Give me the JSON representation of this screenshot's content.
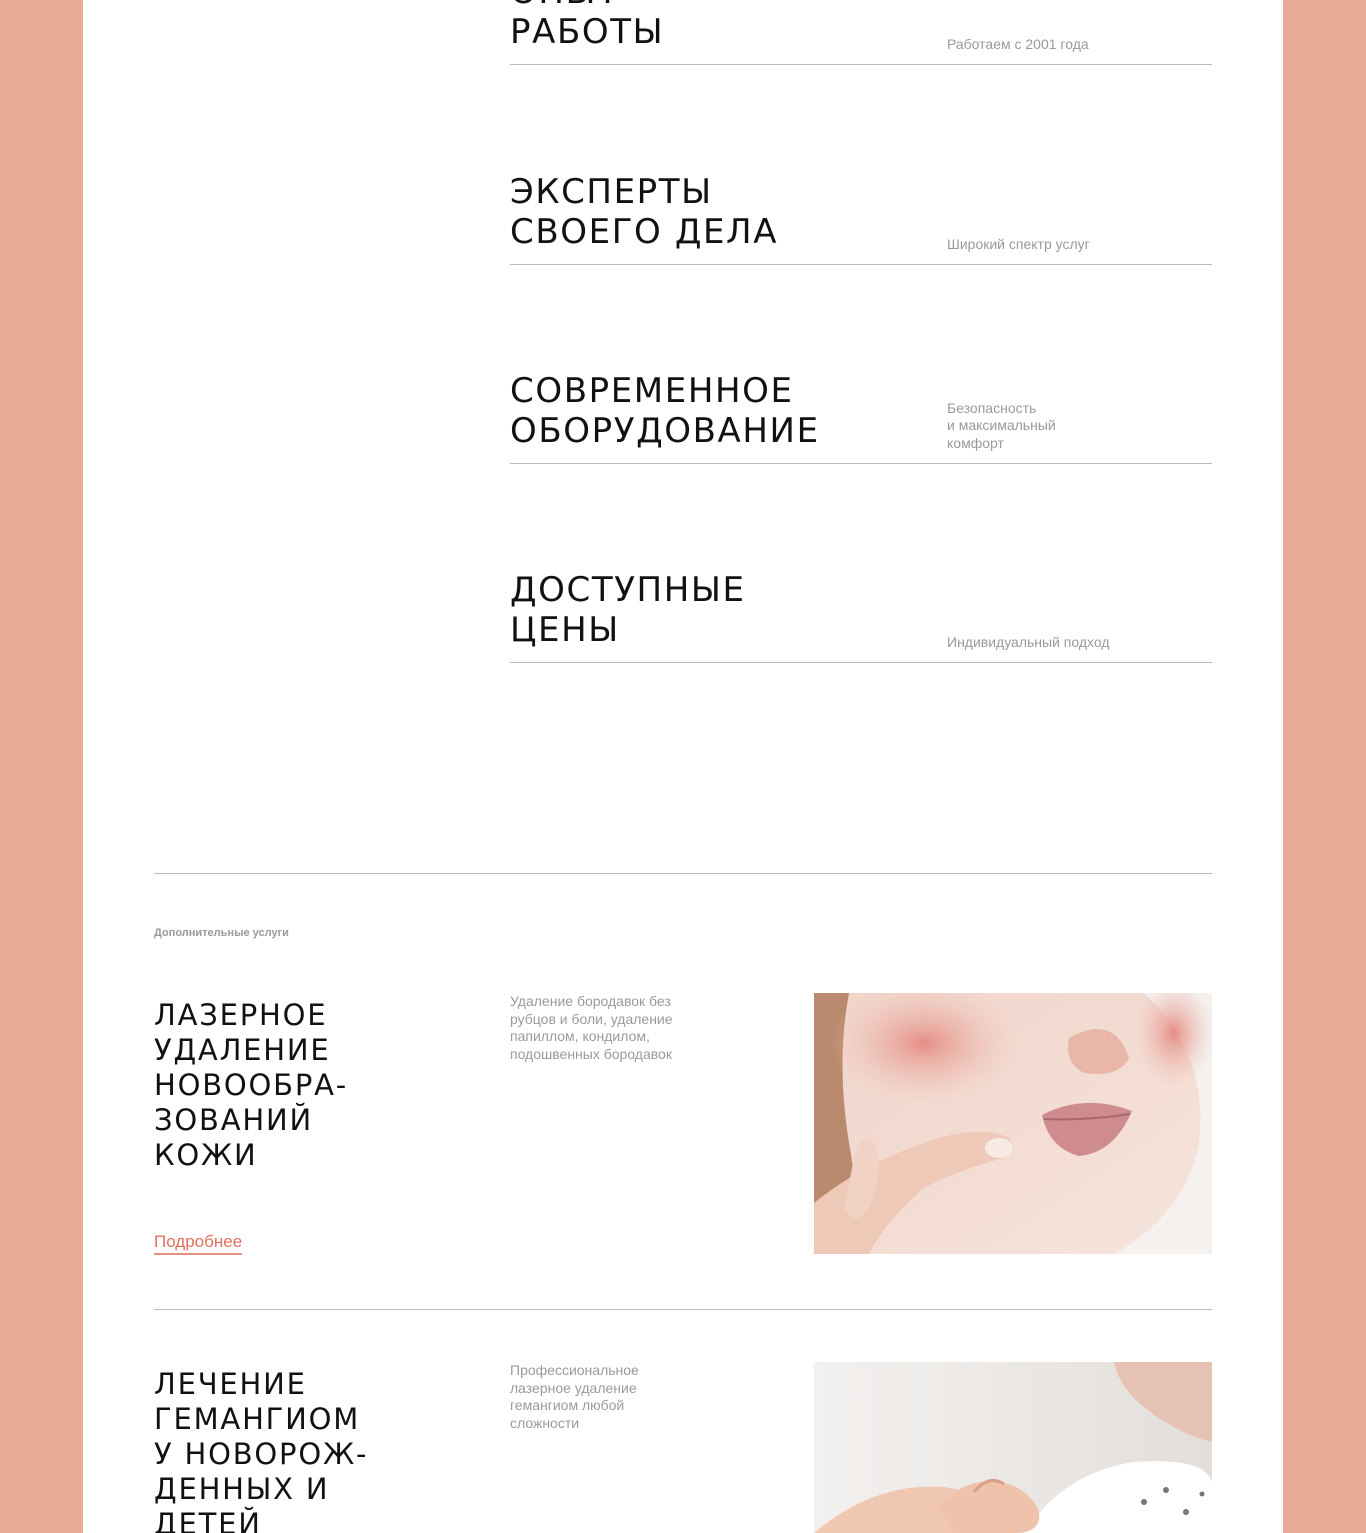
{
  "advantages": [
    {
      "title": "Опыт\nработы",
      "desc": "Работаем с 2001 года"
    },
    {
      "title": "Эксперты\nсвоего дела",
      "desc": "Широкий спектр услуг"
    },
    {
      "title": "Современное\nоборудование",
      "desc": "Безопасность\nи максимальный\nкомфорт"
    },
    {
      "title": "Доступные\nцены",
      "desc": "Индивидуальный подход"
    }
  ],
  "services_section": {
    "eyebrow": "Дополнительные услуги",
    "items": [
      {
        "title": "Лазерное\nудаление\nновообра-\nзований\nкожи",
        "desc": "Удаление бородавок без\nрубцов и боли, удаление\nпапиллом, кондилом,\nподошвенных бородавок",
        "link": "Подробнее",
        "photo": "woman-face-skin-photo"
      },
      {
        "title": "Лечение\nгемангиом\nу новорож-\nденных и\nдетей",
        "desc": "Профессиональное\nлазерное удаление\nгемангиом любой\nсложности",
        "photo": "baby-hand-photo"
      }
    ]
  },
  "colors": {
    "background": "#e8ab96",
    "page": "#ffffff",
    "accent": "#e0705f",
    "muted_text": "#9a9a9a",
    "divider": "#b9b9b9"
  }
}
